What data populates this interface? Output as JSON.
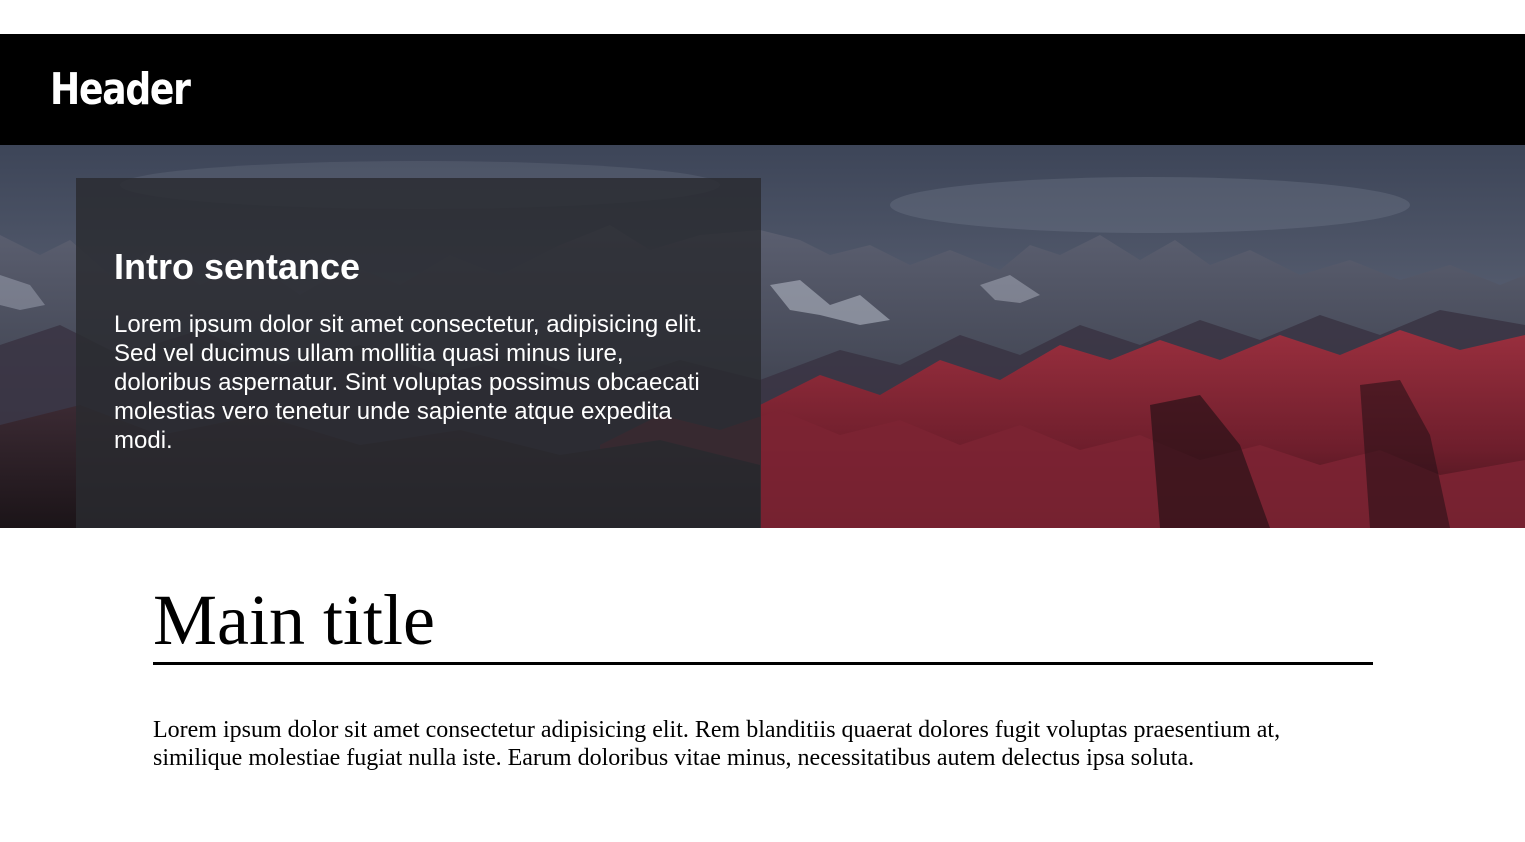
{
  "header": {
    "title": "Header",
    "background": "#000000"
  },
  "hero": {
    "image": "mountain-landscape-photo",
    "intro": {
      "title": "Intro sentance",
      "text": "Lorem ipsum dolor sit amet consectetur, adipisicing elit. Sed vel ducimus ullam mollitia quasi minus iure, doloribus aspernatur. Sint voluptas possimus obcaecati molestias vero tenetur unde sapiente atque expedita modi."
    }
  },
  "main": {
    "title": "Main title",
    "text": "Lorem ipsum dolor sit amet consectetur adipisicing elit. Rem blanditiis quaerat dolores fugit voluptas praesentium at, similique molestiae fugiat nulla iste. Earum doloribus vitae minus, necessitatibus autem delectus ipsa soluta."
  }
}
